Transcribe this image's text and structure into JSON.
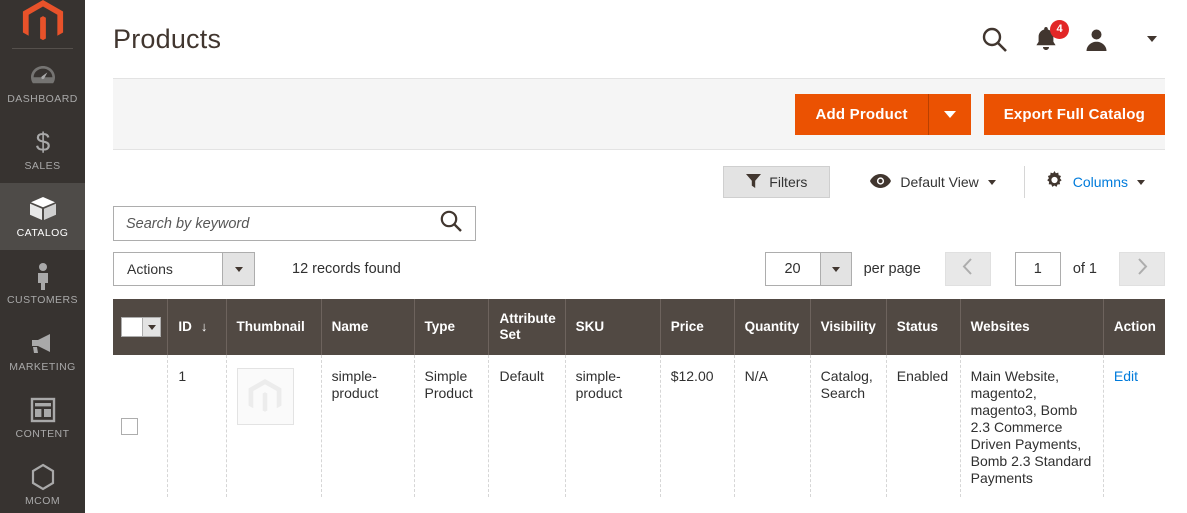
{
  "brand": {
    "logo_icon": "magento-logo",
    "accent": "#eb5202",
    "sidebar_bg": "#373330",
    "header_bg": "#514943",
    "link_color": "#007bdb"
  },
  "sidebar": {
    "items": [
      {
        "label": "DASHBOARD",
        "icon": "dashboard-icon",
        "active": false
      },
      {
        "label": "SALES",
        "icon": "dollar-icon",
        "active": false
      },
      {
        "label": "CATALOG",
        "icon": "box-icon",
        "active": true
      },
      {
        "label": "CUSTOMERS",
        "icon": "person-icon",
        "active": false
      },
      {
        "label": "MARKETING",
        "icon": "megaphone-icon",
        "active": false
      },
      {
        "label": "CONTENT",
        "icon": "layout-icon",
        "active": false
      },
      {
        "label": "MCOM",
        "icon": "hexagon-icon",
        "active": false
      }
    ]
  },
  "header": {
    "title": "Products",
    "search_icon": "search-icon",
    "notifications_icon": "bell-icon",
    "notifications_count": "4",
    "account_icon": "user-icon",
    "account_caret_icon": "chevron-down-icon"
  },
  "page_actions": {
    "add_product_label": "Add Product",
    "add_product_caret_icon": "caret-down-icon",
    "export_label": "Export Full Catalog"
  },
  "controls": {
    "filters_label": "Filters",
    "filters_icon": "funnel-icon",
    "view_label": "Default View",
    "view_icon": "eye-icon",
    "view_caret_icon": "caret-down-icon",
    "columns_label": "Columns",
    "columns_icon": "gear-icon",
    "columns_caret_icon": "caret-down-icon"
  },
  "search": {
    "placeholder": "Search by keyword",
    "value": "",
    "icon": "search-icon"
  },
  "actions": {
    "label": "Actions",
    "caret_icon": "caret-down-icon",
    "records_found": "12 records found"
  },
  "pagination": {
    "per_page_value": "20",
    "per_page_caret_icon": "caret-down-icon",
    "per_page_label": "per page",
    "prev_icon": "chevron-left-icon",
    "next_icon": "chevron-right-icon",
    "current_page": "1",
    "of_label": "of 1"
  },
  "table": {
    "select_all_icon": "checkbox-dropdown",
    "sort_icon": "arrow-down-icon",
    "columns": [
      {
        "label": "ID",
        "sorted": true
      },
      {
        "label": "Thumbnail"
      },
      {
        "label": "Name"
      },
      {
        "label": "Type"
      },
      {
        "label": "Attribute Set"
      },
      {
        "label": "SKU"
      },
      {
        "label": "Price"
      },
      {
        "label": "Quantity"
      },
      {
        "label": "Visibility"
      },
      {
        "label": "Status"
      },
      {
        "label": "Websites"
      },
      {
        "label": "Action"
      }
    ],
    "rows": [
      {
        "id": "1",
        "thumbnail_icon": "magento-placeholder-image",
        "name": "simple-product",
        "type": "Simple Product",
        "attribute_set": "Default",
        "sku": "simple-product",
        "price": "$12.00",
        "quantity": "N/A",
        "visibility": "Catalog, Search",
        "status": "Enabled",
        "websites": "Main Website, magento2, magento3, Bomb 2.3 Commerce Driven Payments, Bomb 2.3 Standard Payments",
        "action": "Edit"
      }
    ]
  }
}
